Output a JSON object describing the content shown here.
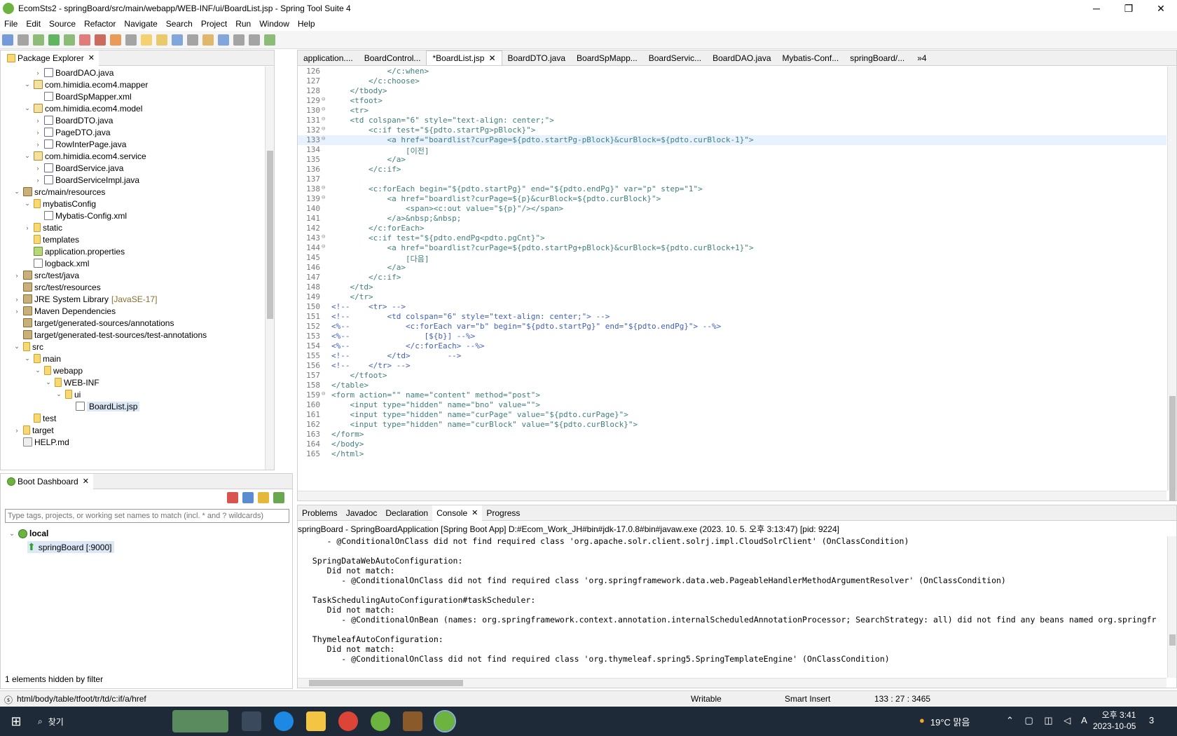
{
  "window": {
    "title": "EcomSts2 - springBoard/src/main/webapp/WEB-INF/ui/BoardList.jsp - Spring Tool Suite 4",
    "minimize": "─",
    "maximize": "❐",
    "close": "✕"
  },
  "menu": [
    "File",
    "Edit",
    "Source",
    "Refactor",
    "Navigate",
    "Search",
    "Project",
    "Run",
    "Window",
    "Help"
  ],
  "package_explorer": {
    "tab": "Package Explorer",
    "items": [
      {
        "indent": 3,
        "tw": "›",
        "icon": "java",
        "label": "BoardDAO.java"
      },
      {
        "indent": 2,
        "tw": "⌄",
        "icon": "pkg",
        "label": "com.himidia.ecom4.mapper"
      },
      {
        "indent": 3,
        "tw": "",
        "icon": "xml",
        "label": "BoardSpMapper.xml"
      },
      {
        "indent": 2,
        "tw": "⌄",
        "icon": "pkg",
        "label": "com.himidia.ecom4.model"
      },
      {
        "indent": 3,
        "tw": "›",
        "icon": "java",
        "label": "BoardDTO.java"
      },
      {
        "indent": 3,
        "tw": "›",
        "icon": "java",
        "label": "PageDTO.java"
      },
      {
        "indent": 3,
        "tw": "›",
        "icon": "java",
        "label": "RowInterPage.java"
      },
      {
        "indent": 2,
        "tw": "⌄",
        "icon": "pkg",
        "label": "com.himidia.ecom4.service"
      },
      {
        "indent": 3,
        "tw": "›",
        "icon": "java",
        "label": "BoardService.java"
      },
      {
        "indent": 3,
        "tw": "›",
        "icon": "java",
        "label": "BoardServiceImpl.java"
      },
      {
        "indent": 1,
        "tw": "⌄",
        "icon": "jar",
        "label": "src/main/resources"
      },
      {
        "indent": 2,
        "tw": "⌄",
        "icon": "fold",
        "label": "mybatisConfig"
      },
      {
        "indent": 3,
        "tw": "",
        "icon": "xml",
        "label": "Mybatis-Config.xml"
      },
      {
        "indent": 2,
        "tw": "›",
        "icon": "fold",
        "label": "static"
      },
      {
        "indent": 2,
        "tw": "",
        "icon": "fold",
        "label": "templates"
      },
      {
        "indent": 2,
        "tw": "",
        "icon": "prop",
        "label": "application.properties"
      },
      {
        "indent": 2,
        "tw": "",
        "icon": "xml",
        "label": "logback.xml"
      },
      {
        "indent": 1,
        "tw": "›",
        "icon": "jar",
        "label": "src/test/java"
      },
      {
        "indent": 1,
        "tw": "",
        "icon": "jar",
        "label": "src/test/resources"
      },
      {
        "indent": 1,
        "tw": "›",
        "icon": "jar",
        "label": "JRE System Library",
        "extra": "[JavaSE-17]"
      },
      {
        "indent": 1,
        "tw": "›",
        "icon": "jar",
        "label": "Maven Dependencies"
      },
      {
        "indent": 1,
        "tw": "",
        "icon": "jar",
        "label": "target/generated-sources/annotations"
      },
      {
        "indent": 1,
        "tw": "",
        "icon": "jar",
        "label": "target/generated-test-sources/test-annotations"
      },
      {
        "indent": 1,
        "tw": "⌄",
        "icon": "fold",
        "label": "src"
      },
      {
        "indent": 2,
        "tw": "⌄",
        "icon": "fold",
        "label": "main"
      },
      {
        "indent": 3,
        "tw": "⌄",
        "icon": "fold",
        "label": "webapp"
      },
      {
        "indent": 4,
        "tw": "⌄",
        "icon": "fold",
        "label": "WEB-INF"
      },
      {
        "indent": 5,
        "tw": "⌄",
        "icon": "fold",
        "label": "ui"
      },
      {
        "indent": 6,
        "tw": "",
        "icon": "jsp",
        "label": "BoardList.jsp",
        "selected": true
      },
      {
        "indent": 2,
        "tw": "",
        "icon": "fold",
        "label": "test"
      },
      {
        "indent": 1,
        "tw": "›",
        "icon": "fold",
        "label": "target"
      },
      {
        "indent": 1,
        "tw": "",
        "icon": "md",
        "label": "HELP.md"
      }
    ]
  },
  "boot_dashboard": {
    "tab": "Boot Dashboard",
    "filter_placeholder": "Type tags, projects, or working set names to match (incl. * and ? wildcards)",
    "local": "local",
    "app": "springBoard [:9000]",
    "hidden": "1 elements hidden by filter"
  },
  "editor": {
    "tabs": [
      "application....",
      "BoardControl...",
      "*BoardList.jsp",
      "BoardDTO.java",
      "BoardSpMapp...",
      "BoardServic...",
      "BoardDAO.java",
      "Mybatis-Conf...",
      "springBoard/..."
    ],
    "overflow": "»4",
    "current_line": 133,
    "lines": [
      {
        "n": 126,
        "f": "",
        "t": "            </c:when>"
      },
      {
        "n": 127,
        "f": "",
        "t": "        </c:choose>"
      },
      {
        "n": 128,
        "f": "",
        "t": "    </tbody>"
      },
      {
        "n": 129,
        "f": "⊖",
        "t": "    <tfoot>"
      },
      {
        "n": 130,
        "f": "⊖",
        "t": "    <tr>"
      },
      {
        "n": 131,
        "f": "⊖",
        "t": "    <td colspan=\"6\" style=\"text-align: center;\">"
      },
      {
        "n": 132,
        "f": "⊖",
        "t": "        <c:if test=\"${pdto.startPg>pBlock}\">"
      },
      {
        "n": 133,
        "f": "⊖",
        "t": "            <a href=\"boardlist?curPage=${pdto.startPg-pBlock}&curBlock=${pdto.curBlock-1}\">"
      },
      {
        "n": 134,
        "f": "",
        "t": "                [이전]"
      },
      {
        "n": 135,
        "f": "",
        "t": "            </a>"
      },
      {
        "n": 136,
        "f": "",
        "t": "        </c:if>"
      },
      {
        "n": 137,
        "f": "",
        "t": ""
      },
      {
        "n": 138,
        "f": "⊖",
        "t": "        <c:forEach begin=\"${pdto.startPg}\" end=\"${pdto.endPg}\" var=\"p\" step=\"1\">"
      },
      {
        "n": 139,
        "f": "⊖",
        "t": "            <a href=\"boardlist?curPage=${p}&curBlock=${pdto.curBlock}\">"
      },
      {
        "n": 140,
        "f": "",
        "t": "                <span><c:out value=\"${p}\"/></span>"
      },
      {
        "n": 141,
        "f": "",
        "t": "            </a>&nbsp;&nbsp;"
      },
      {
        "n": 142,
        "f": "",
        "t": "        </c:forEach>"
      },
      {
        "n": 143,
        "f": "⊖",
        "t": "        <c:if test=\"${pdto.endPg<pdto.pgCnt}\">"
      },
      {
        "n": 144,
        "f": "⊖",
        "t": "            <a href=\"boardlist?curPage=${pdto.startPg+pBlock}&curBlock=${pdto.curBlock+1}\">"
      },
      {
        "n": 145,
        "f": "",
        "t": "                [다음]"
      },
      {
        "n": 146,
        "f": "",
        "t": "            </a>"
      },
      {
        "n": 147,
        "f": "",
        "t": "        </c:if>"
      },
      {
        "n": 148,
        "f": "",
        "t": "    </td>"
      },
      {
        "n": 149,
        "f": "",
        "t": "    </tr>"
      },
      {
        "n": 150,
        "f": "",
        "t": "<!--    <tr> -->"
      },
      {
        "n": 151,
        "f": "",
        "t": "<!--        <td colspan=\"6\" style=\"text-align: center;\"> -->"
      },
      {
        "n": 152,
        "f": "",
        "t": "<%--            <c:forEach var=\"b\" begin=\"${pdto.startPg}\" end=\"${pdto.endPg}\"> --%>"
      },
      {
        "n": 153,
        "f": "",
        "t": "<%--                [${b}] --%>"
      },
      {
        "n": 154,
        "f": "",
        "t": "<%--            </c:forEach> --%>"
      },
      {
        "n": 155,
        "f": "",
        "t": "<!--        </td>        -->"
      },
      {
        "n": 156,
        "f": "",
        "t": "<!--    </tr> -->"
      },
      {
        "n": 157,
        "f": "",
        "t": "    </tfoot>"
      },
      {
        "n": 158,
        "f": "",
        "t": "</table>"
      },
      {
        "n": 159,
        "f": "⊖",
        "t": "<form action=\"\" name=\"content\" method=\"post\">"
      },
      {
        "n": 160,
        "f": "",
        "t": "    <input type=\"hidden\" name=\"bno\" value=\"\">"
      },
      {
        "n": 161,
        "f": "",
        "t": "    <input type=\"hidden\" name=\"curPage\" value=\"${pdto.curPage}\">"
      },
      {
        "n": 162,
        "f": "",
        "t": "    <input type=\"hidden\" name=\"curBlock\" value=\"${pdto.curBlock}\">"
      },
      {
        "n": 163,
        "f": "",
        "t": "</form>"
      },
      {
        "n": 164,
        "f": "",
        "t": "</body>"
      },
      {
        "n": 165,
        "f": "",
        "t": "</html>"
      }
    ]
  },
  "console": {
    "tabs": [
      "Problems",
      "Javadoc",
      "Declaration",
      "Console",
      "Progress"
    ],
    "active": "Console",
    "header": "springBoard - SpringBoardApplication [Spring Boot App] D:#Ecom_Work_JH#bin#jdk-17.0.8#bin#javaw.exe  (2023. 10. 5. 오후 3:13:47) [pid: 9224]",
    "lines": [
      "      - @ConditionalOnClass did not find required class 'org.apache.solr.client.solrj.impl.CloudSolrClient' (OnClassCondition)",
      "",
      "   SpringDataWebAutoConfiguration:",
      "      Did not match:",
      "         - @ConditionalOnClass did not find required class 'org.springframework.data.web.PageableHandlerMethodArgumentResolver' (OnClassCondition)",
      "",
      "   TaskSchedulingAutoConfiguration#taskScheduler:",
      "      Did not match:",
      "         - @ConditionalOnBean (names: org.springframework.context.annotation.internalScheduledAnnotationProcessor; SearchStrategy: all) did not find any beans named org.springfr",
      "",
      "   ThymeleafAutoConfiguration:",
      "      Did not match:",
      "         - @ConditionalOnClass did not find required class 'org.thymeleaf.spring5.SpringTemplateEngine' (OnClassCondition)"
    ]
  },
  "status": {
    "path": "html/body/table/tfoot/tr/td/c:if/a/href",
    "writable": "Writable",
    "insert": "Smart Insert",
    "position": "133 : 27 : 3465"
  },
  "taskbar": {
    "search": "찾기",
    "weather": "19°C 맑음",
    "time": "오후 3:41",
    "date": "2023-10-05",
    "notif": "3"
  }
}
